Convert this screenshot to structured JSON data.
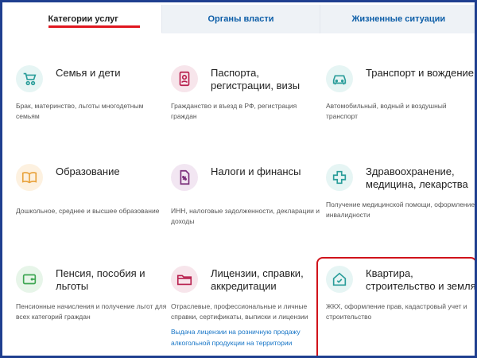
{
  "tabs": [
    {
      "label": "Категории услуг",
      "active": true
    },
    {
      "label": "Органы власти",
      "active": false
    },
    {
      "label": "Жизненные ситуации",
      "active": false
    }
  ],
  "colors": {
    "teal": "#2a9d9a",
    "crimson": "#b8204e",
    "purple": "#7a2d7a",
    "orange": "#e8a23c",
    "green": "#3ea653",
    "highlight_border": "#d0131b",
    "tab_underline": "#e0161e",
    "frame": "#1f3f8f"
  },
  "categories": [
    {
      "icon": "stroller-icon",
      "title": "Семья и дети",
      "desc": "Брак, материнство, льготы многодетным семьям"
    },
    {
      "icon": "passport-icon",
      "title": "Паспорта, регистрации, визы",
      "desc": "Гражданство и въезд в РФ, регистрация граждан"
    },
    {
      "icon": "car-icon",
      "title": "Транспорт и вождение",
      "desc": "Автомобильный, водный и воздушный транспорт"
    },
    {
      "icon": "book-icon",
      "title": "Образование",
      "desc": "Дошкольное, среднее и высшее образование"
    },
    {
      "icon": "tax-document-icon",
      "title": "Налоги и финансы",
      "desc": "ИНН, налоговые задолженности, декларации и доходы"
    },
    {
      "icon": "medical-cross-icon",
      "title": "Здравоохранение, медицина, лекарства",
      "desc": "Получение медицинской помощи, оформление инвалидности"
    },
    {
      "icon": "wallet-icon",
      "title": "Пенсия, пособия и льготы",
      "desc": "Пенсионные начисления и получение льгот для всех категорий граждан"
    },
    {
      "icon": "folder-icon",
      "title": "Лицензии, справки, аккредитации",
      "desc": "Отраслевые, профессиональные и личные справки, сертификаты, выписки и лицензии",
      "link": "Выдача лицензии на розничную продажу алкогольной продукции на территории"
    },
    {
      "icon": "house-check-icon",
      "title": "Квартира, строительство и земля",
      "desc": "ЖКХ, оформление прав, кадастровый учет и строительство"
    }
  ]
}
